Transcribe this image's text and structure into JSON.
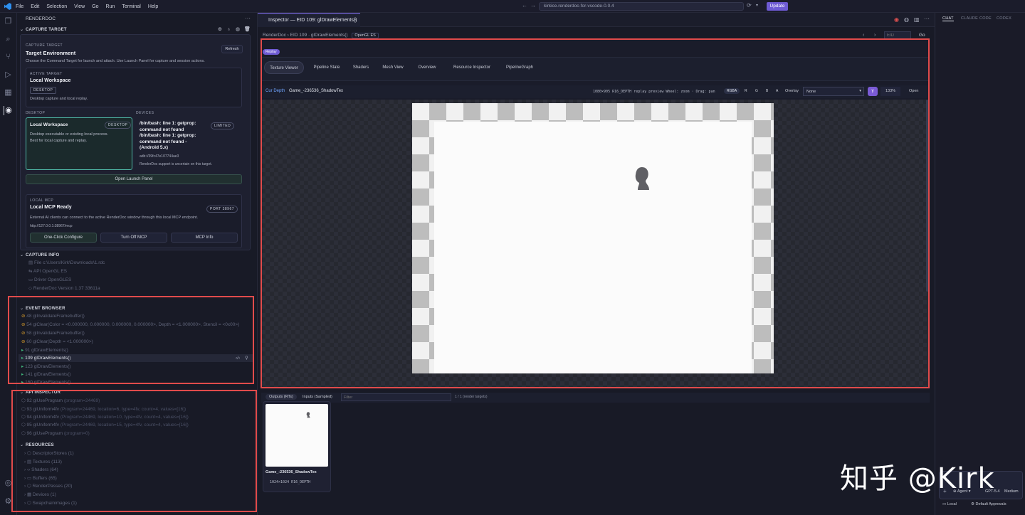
{
  "menu": {
    "items": [
      "File",
      "Edit",
      "Selection",
      "View",
      "Go",
      "Run",
      "Terminal",
      "Help"
    ],
    "search": "kirkice.renderdoc-for-vscode-0.0.4",
    "update": "Update"
  },
  "sidebar": {
    "title": "RENDERDOC",
    "capture_target": {
      "header": "CAPTURE TARGET",
      "eyebrow": "CAPTURE TARGET",
      "title": "Target Environment",
      "refresh": "Refresh",
      "description": "Choose the Command Target for launch and attach. Use Launch Panel for capture and session actions.",
      "active": {
        "eyebrow": "ACTIVE TARGET",
        "title": "Local Workspace",
        "tag": "DESKTOP",
        "note": "Desktop capture and local replay."
      },
      "desktop_label": "DESKTOP",
      "devices_label": "DEVICES",
      "desktop_card": {
        "title": "Local Workspace",
        "tag": "DESKTOP",
        "line1": "Desktop executable or existing local process.",
        "line2": "Best for local capture and replay."
      },
      "device_card": {
        "title": "/bin/bash: line 1: getprop: command not found /bin/bash: line 1: getprop: command not found - (Android 5.x)",
        "tag": "LIMITED",
        "id": "adb://39fc47e107744ae3",
        "note": "RenderDoc support is uncertain on this target."
      },
      "launch": "Open Launch Panel",
      "mcp": {
        "eyebrow": "LOCAL MCP",
        "title": "Local MCP Ready",
        "tag": "PORT 38967",
        "description": "External AI clients can connect to the active RenderDoc window through this local MCP endpoint.",
        "url": "http://127.0.0.1:38967/mcp",
        "btn1": "One-Click Configure",
        "btn2": "Turn Off MCP",
        "btn3": "MCP Info"
      }
    },
    "capture_info": {
      "header": "CAPTURE INFO",
      "rows": [
        {
          "k": "File",
          "v": "c:\\Users\\Kirk\\Downloads\\1.rdc"
        },
        {
          "k": "API",
          "v": "OpenGL ES"
        },
        {
          "k": "Driver",
          "v": "OpenGLES"
        },
        {
          "k": "RenderDoc Version",
          "v": "1.37 33611a"
        }
      ]
    },
    "event_browser": {
      "header": "EVENT BROWSER",
      "rows": [
        {
          "id": "48",
          "t": "glInvalidateFramebuffer()"
        },
        {
          "id": "54",
          "t": "glClear(Color = <0.000000, 0.000000, 0.000000, 0.000000>, Depth = <1.000000>, Stencil = <0x00>)"
        },
        {
          "id": "58",
          "t": "glInvalidateFramebuffer()"
        },
        {
          "id": "60",
          "t": "glClear(Depth = <1.000000>)"
        },
        {
          "id": "91",
          "t": "glDrawElements()"
        },
        {
          "id": "109",
          "t": "glDrawElements()"
        },
        {
          "id": "123",
          "t": "glDrawElements()"
        },
        {
          "id": "141",
          "t": "glDrawElements()"
        },
        {
          "id": "160",
          "t": "glDrawElements()"
        }
      ]
    },
    "api_inspector": {
      "header": "API INSPECTOR",
      "rows": [
        {
          "id": "92",
          "t": "glUseProgram",
          "a": "(program=24469)"
        },
        {
          "id": "93",
          "t": "glUniform4fv",
          "a": "(Program=24469, location=6, type=4fv, count=4, values=[16])"
        },
        {
          "id": "94",
          "t": "glUniform4fv",
          "a": "(Program=24469, location=10, type=4fv, count=4, values=[16])"
        },
        {
          "id": "95",
          "t": "glUniform4fv",
          "a": "(Program=24469, location=15, type=4fv, count=4, values=[16])"
        },
        {
          "id": "96",
          "t": "glUseProgram",
          "a": "(program=0)"
        }
      ]
    },
    "resources": {
      "header": "RESOURCES",
      "rows": [
        "DescriptorStores (1)",
        "Textures (113)",
        "Shaders (64)",
        "Buffers (65)",
        "RenderPasses (20)",
        "Devices (1)",
        "Swapchainimages (1)"
      ]
    }
  },
  "editor": {
    "tab": "Inspector — EID 109: glDrawElements()",
    "breadcrumb": "RenderDoc › EID 109 · glDrawElements()",
    "badge": "OpenGL ES",
    "eid_placeholder": "EID",
    "go": "Go",
    "replay": "Replay",
    "tabs": [
      "Texture Viewer",
      "Pipeline State",
      "Shaders",
      "Mesh View",
      "Overview",
      "Resource Inspector",
      "PipelineGraph"
    ],
    "toolbar": {
      "label": "Cur Depth",
      "name": "Game_-236536_ShadowTex",
      "info": "1080×905 R16_DEPTH  replay preview  Wheel: zoom · Drag: pan",
      "chans": [
        "RGBA",
        "R",
        "G",
        "B",
        "A"
      ],
      "overlay": "Overlay",
      "overlay_value": "None",
      "zoom": "133%",
      "open": "Open"
    },
    "bottom": {
      "tab1": "Outputs (RTs)",
      "tab2": "Inputs (Sampled)",
      "filter": "Filter",
      "count": "1 / 1 (render targets)"
    },
    "thumb": {
      "name": "Game_-236536_ShadowTex",
      "info": "1024×1024 R16_DEPTH"
    }
  },
  "right": {
    "tabs": [
      "CHAT",
      "CLAUDE CODE",
      "CODEX"
    ],
    "agent": "Agent",
    "model": "GPT-5.4",
    "effort": "Medium",
    "local": "Local",
    "approvals": "Default Approvals"
  },
  "watermark": "知乎 @Kirk"
}
